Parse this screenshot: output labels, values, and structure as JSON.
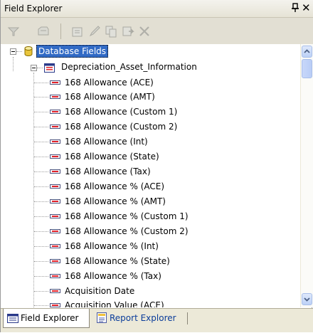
{
  "window": {
    "title": "Field Explorer",
    "close_glyph": "✕"
  },
  "toolbar": {
    "buttons": [
      {
        "icon": "filter-icon",
        "enabled": false
      },
      {
        "icon": "view-icon",
        "enabled": false
      },
      {
        "icon": "insert-field-icon",
        "enabled": false
      },
      {
        "icon": "edit-icon",
        "enabled": false
      },
      {
        "icon": "copy-icon",
        "enabled": false
      },
      {
        "icon": "rename-icon",
        "enabled": false
      },
      {
        "icon": "delete-icon",
        "enabled": false
      }
    ]
  },
  "tree": {
    "root_label": "Database Fields",
    "table_label": "Depreciation_Asset_Information",
    "fields": [
      "168 Allowance (ACE)",
      "168 Allowance (AMT)",
      "168 Allowance (Custom 1)",
      "168 Allowance (Custom 2)",
      "168 Allowance (Int)",
      "168 Allowance (State)",
      "168 Allowance (Tax)",
      "168 Allowance % (ACE)",
      "168 Allowance % (AMT)",
      "168 Allowance % (Custom 1)",
      "168 Allowance % (Custom 2)",
      "168 Allowance % (Int)",
      "168 Allowance % (State)",
      "168 Allowance % (Tax)",
      "Acquisition Date",
      "Acquisition Value (ACE)"
    ]
  },
  "tabs": [
    {
      "label": "Field Explorer",
      "active": true
    },
    {
      "label": "Report Explorer",
      "active": false
    }
  ],
  "colors": {
    "selection": "#316ac5",
    "link": "#0a3c9a"
  }
}
